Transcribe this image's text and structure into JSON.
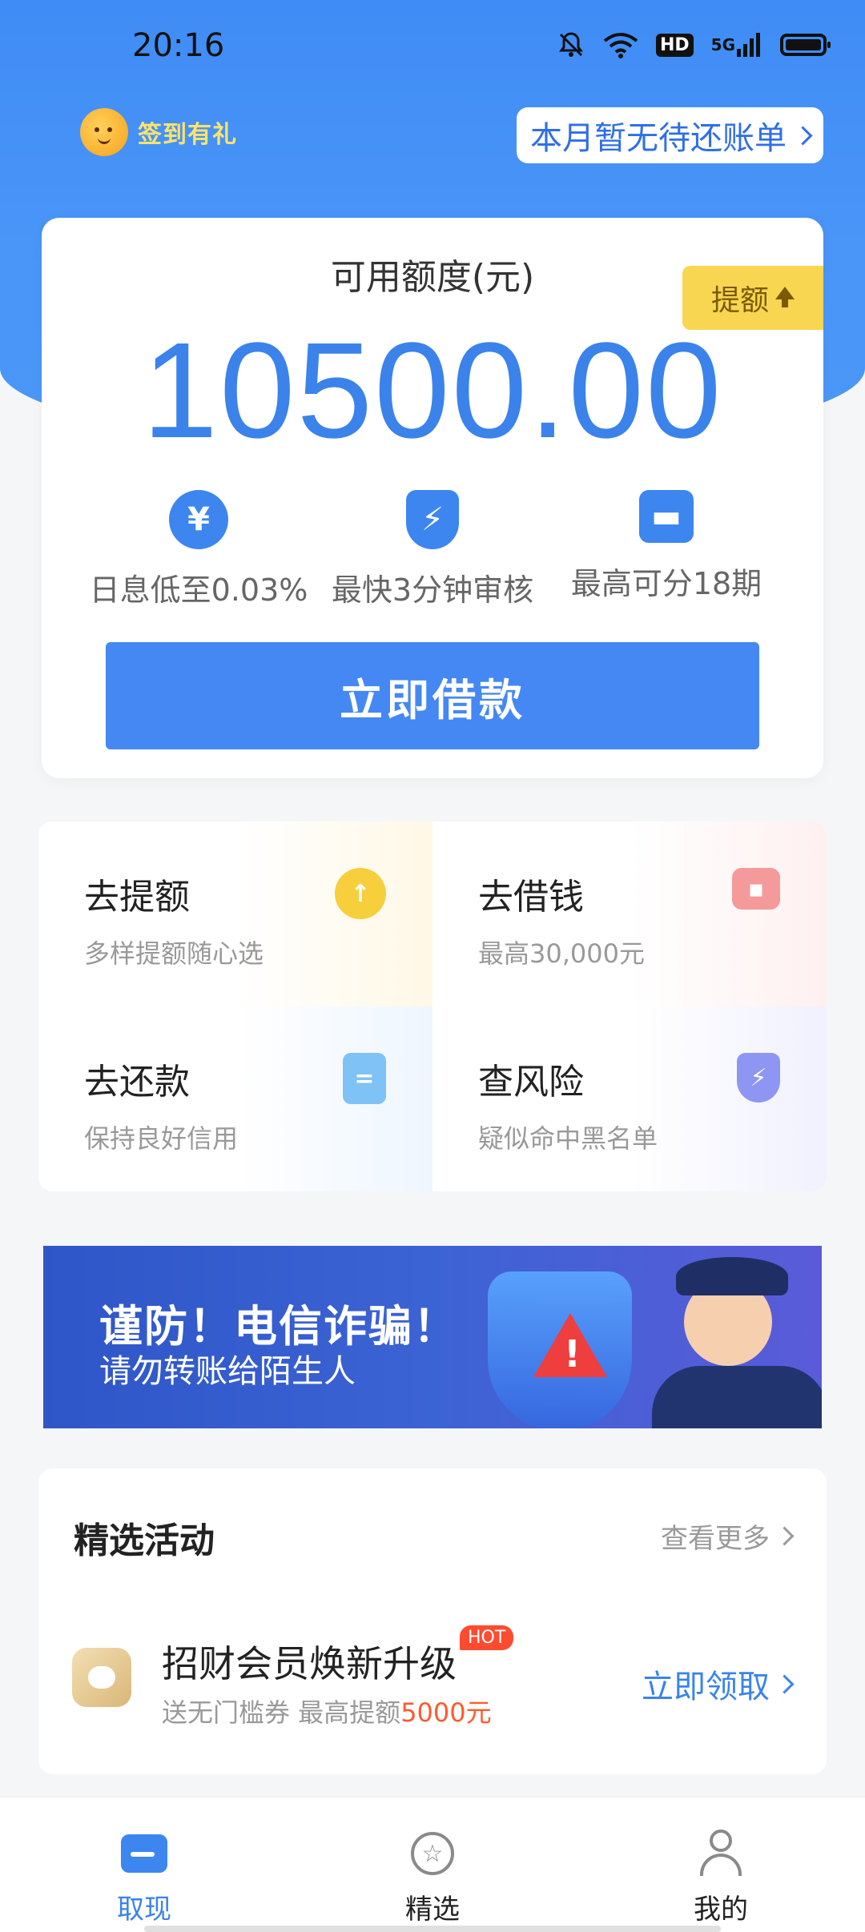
{
  "status_bar": {
    "time": "20:16",
    "icons": [
      "mute-bell-icon",
      "wifi-icon",
      "hd-icon",
      "5g-signal-icon",
      "battery-icon"
    ],
    "hd_label": "HD",
    "signal_label": "5G"
  },
  "header": {
    "checkin_label": "签到有礼",
    "bill_label": "本月暂无待还账单"
  },
  "credit": {
    "title": "可用额度(元)",
    "amount": "10500.00",
    "raise_label": "提额",
    "features": [
      {
        "icon": "yuan-icon",
        "glyph": "¥",
        "label": "日息低至0.03%"
      },
      {
        "icon": "shield-lightning-icon",
        "glyph": "⚡",
        "label": "最快3分钟审核"
      },
      {
        "icon": "calendar-icon",
        "glyph": "▬",
        "label": "最高可分18期"
      }
    ],
    "borrow_button": "立即借款"
  },
  "quick_actions": [
    {
      "title": "去提额",
      "subtitle": "多样提额随心选",
      "icon": "up-arrow-icon"
    },
    {
      "title": "去借钱",
      "subtitle": "最高30,000元",
      "icon": "wallet-icon"
    },
    {
      "title": "去还款",
      "subtitle": "保持良好信用",
      "icon": "document-icon"
    },
    {
      "title": "查风险",
      "subtitle": "疑似命中黑名单",
      "icon": "shield-icon"
    }
  ],
  "banner": {
    "line1": "谨防！电信诈骗！",
    "line2": "请勿转账给陌生人"
  },
  "activity": {
    "title": "精选活动",
    "more_label": "查看更多",
    "item": {
      "title": "招财会员焕新升级",
      "badge": "HOT",
      "desc_prefix": "送无门槛券  最高提额",
      "desc_highlight": "5000元",
      "cta": "立即领取"
    }
  },
  "tabbar": {
    "tabs": [
      {
        "label": "取现",
        "icon": "wallet-icon",
        "active": true
      },
      {
        "label": "精选",
        "icon": "star-icon",
        "active": false
      },
      {
        "label": "我的",
        "icon": "user-icon",
        "active": false
      }
    ]
  },
  "colors": {
    "primary": "#4588f3",
    "amount": "#3b83ea",
    "raise_tag": "#f8d651",
    "hot": "#ff4b2f",
    "highlight": "#ff5a2e"
  }
}
